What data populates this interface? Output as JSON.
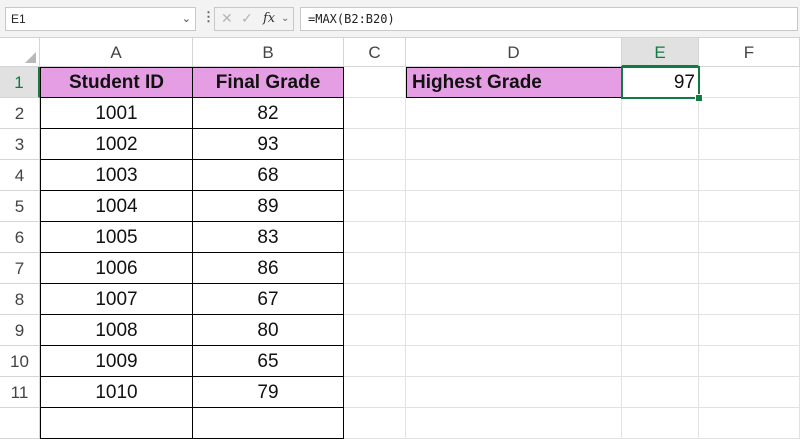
{
  "formula_bar": {
    "name_box": "E1",
    "formula": "=MAX(B2:B20)",
    "fx_label": "fx"
  },
  "columns": [
    "A",
    "B",
    "C",
    "D",
    "E",
    "F"
  ],
  "rows": [
    "1",
    "2",
    "3",
    "4",
    "5",
    "6",
    "7",
    "8",
    "9",
    "10",
    "11"
  ],
  "table": {
    "header": {
      "student_id": "Student ID",
      "final_grade": "Final Grade"
    },
    "records": [
      {
        "id": "1001",
        "grade": "82"
      },
      {
        "id": "1002",
        "grade": "93"
      },
      {
        "id": "1003",
        "grade": "68"
      },
      {
        "id": "1004",
        "grade": "89"
      },
      {
        "id": "1005",
        "grade": "83"
      },
      {
        "id": "1006",
        "grade": "86"
      },
      {
        "id": "1007",
        "grade": "67"
      },
      {
        "id": "1008",
        "grade": "80"
      },
      {
        "id": "1009",
        "grade": "65"
      },
      {
        "id": "1010",
        "grade": "79"
      }
    ]
  },
  "summary": {
    "label": "Highest Grade",
    "value": "97"
  },
  "colors": {
    "header_fill": "#e59ee3",
    "selection": "#107c41"
  }
}
